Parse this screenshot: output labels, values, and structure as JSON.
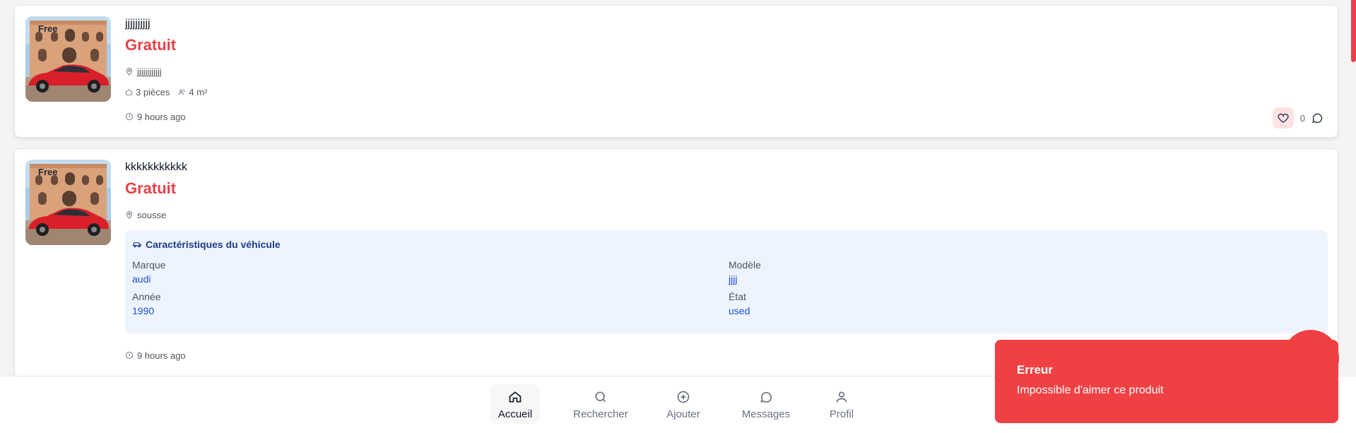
{
  "listings": [
    {
      "badge": "Free",
      "title": "jjjjjjjjjj",
      "price": "Gratuit",
      "location": "jjjjjjjjjjjj",
      "rooms": "3 pièces",
      "area": "4 m²",
      "time": "9 hours ago",
      "likes": "0"
    },
    {
      "badge": "Free",
      "title": "kkkkkkkkkkk",
      "price": "Gratuit",
      "location": "sousse",
      "vehicle": {
        "heading": "Caractéristiques du véhicule",
        "brand_label": "Marque",
        "brand": "audi",
        "model_label": "Modèle",
        "model": "jjjj",
        "year_label": "Année",
        "year": "1990",
        "condition_label": "État",
        "condition": "used"
      },
      "time": "9 hours ago"
    }
  ],
  "nav": [
    {
      "label": "Accueil",
      "icon": "home-icon",
      "active": true
    },
    {
      "label": "Rechercher",
      "icon": "search-icon"
    },
    {
      "label": "Ajouter",
      "icon": "plus-circle-icon"
    },
    {
      "label": "Messages",
      "icon": "message-icon"
    },
    {
      "label": "Profil",
      "icon": "user-icon"
    }
  ],
  "toast": {
    "title": "Erreur",
    "message": "Impossible d'aimer ce produit"
  },
  "colors": {
    "price": "#e84149",
    "toast": "#ef4144",
    "vehicle_box": "#eef4fd",
    "vehicle_value": "#1d4ed8"
  }
}
